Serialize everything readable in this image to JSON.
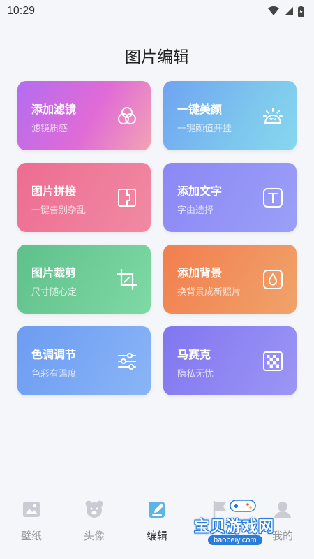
{
  "status_bar": {
    "time": "10:29"
  },
  "page_title": "图片编辑",
  "cards": [
    {
      "name": "添加滤镜",
      "desc": "滤镜质感",
      "icon": "filter-circles-icon"
    },
    {
      "name": "一键美颜",
      "desc": "一键颜值开挂",
      "icon": "beauty-face-icon"
    },
    {
      "name": "图片拼接",
      "desc": "一键告别杂乱",
      "icon": "collage-icon"
    },
    {
      "name": "添加文字",
      "desc": "字由选择",
      "icon": "text-icon"
    },
    {
      "name": "图片裁剪",
      "desc": "尺寸随心定",
      "icon": "crop-icon"
    },
    {
      "name": "添加背景",
      "desc": "换背景成新照片",
      "icon": "drop-icon"
    },
    {
      "name": "色调调节",
      "desc": "色彩有温度",
      "icon": "sliders-icon"
    },
    {
      "name": "马赛克",
      "desc": "隐私无忧",
      "icon": "mosaic-icon"
    }
  ],
  "nav": [
    {
      "label": "壁纸",
      "icon": "wallpaper-icon",
      "active": false
    },
    {
      "label": "头像",
      "icon": "bear-avatar-icon",
      "active": false
    },
    {
      "label": "编辑",
      "icon": "edit-icon",
      "active": true
    },
    {
      "label": "",
      "icon": "flag-icon",
      "active": false
    },
    {
      "label": "我的",
      "icon": "user-icon",
      "active": false
    }
  ],
  "watermark": {
    "text": "宝贝游戏网",
    "url": "baobeiy.com"
  },
  "colors": {
    "nav_active": "#5bb5e6",
    "nav_inactive": "#c9ccd3"
  }
}
